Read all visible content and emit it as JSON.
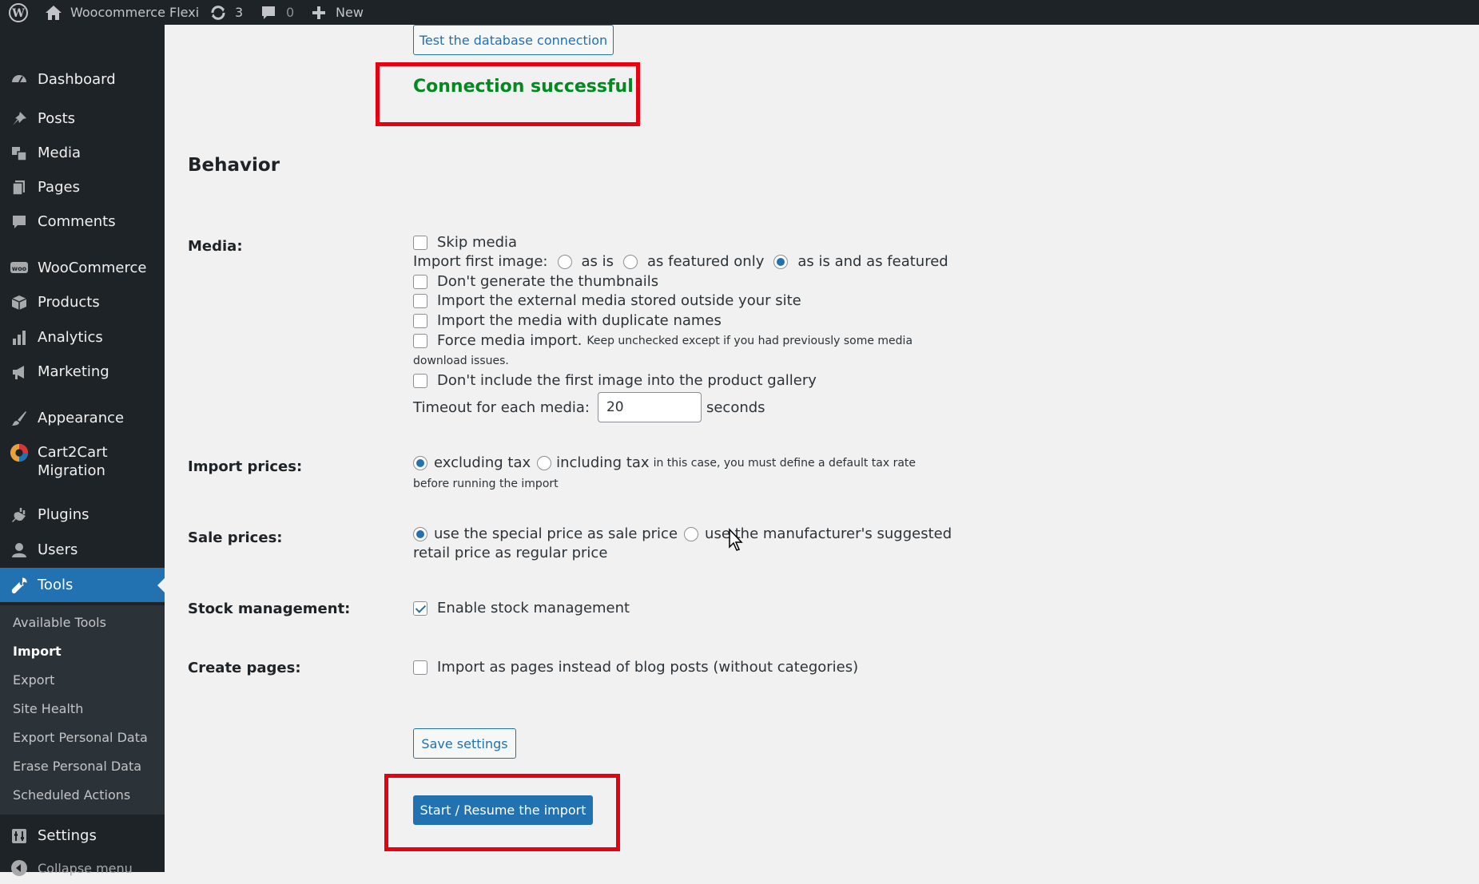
{
  "adminbar": {
    "site_name": "Woocommerce Flexi",
    "updates_count": "3",
    "comments_count": "0",
    "new_label": "New",
    "icons": [
      "wordpress-icon",
      "home-icon",
      "updates-icon",
      "comments-icon",
      "plus-icon"
    ]
  },
  "sidebar": {
    "items": [
      {
        "label": "Dashboard",
        "icon": "dashboard-icon"
      },
      {
        "label": "Posts",
        "icon": "pin-icon"
      },
      {
        "label": "Media",
        "icon": "media-icon"
      },
      {
        "label": "Pages",
        "icon": "pages-icon"
      },
      {
        "label": "Comments",
        "icon": "comment-icon"
      },
      {
        "label": "WooCommerce",
        "icon": "woo-icon"
      },
      {
        "label": "Products",
        "icon": "products-icon"
      },
      {
        "label": "Analytics",
        "icon": "analytics-icon"
      },
      {
        "label": "Marketing",
        "icon": "megaphone-icon"
      },
      {
        "label": "Appearance",
        "icon": "brush-icon"
      },
      {
        "label": "Cart2Cart Migration",
        "icon": "cart2cart-icon"
      },
      {
        "label": "Plugins",
        "icon": "plug-icon"
      },
      {
        "label": "Users",
        "icon": "user-icon"
      },
      {
        "label": "Tools",
        "icon": "wrench-icon"
      },
      {
        "label": "Settings",
        "icon": "settings-icon"
      },
      {
        "label": "Collapse menu",
        "icon": "collapse-icon"
      }
    ],
    "submenu": [
      "Available Tools",
      "Import",
      "Export",
      "Site Health",
      "Export Personal Data",
      "Erase Personal Data",
      "Scheduled Actions"
    ],
    "active_item": "Tools",
    "active_subitem": "Import"
  },
  "main": {
    "test_connection_button": "Test the database connection",
    "connection_status": "Connection successful",
    "behavior_title": "Behavior",
    "media": {
      "label": "Media:",
      "skip_media": "Skip media",
      "import_first_image_label": "Import first image:",
      "first_image_options": [
        "as is",
        "as featured only",
        "as is and as featured"
      ],
      "first_image_selected": "as is and as featured",
      "dont_generate_thumbnails": "Don't generate the thumbnails",
      "import_external_media": "Import the external media stored outside your site",
      "import_duplicate_names": "Import the media with duplicate names",
      "force_media_import": "Force media import.",
      "force_media_note_1": "Keep unchecked except if you had previously some media",
      "force_media_note_2": "download issues.",
      "dont_include_first_image": "Don't include the first image into the product gallery",
      "timeout_label": "Timeout for each media:",
      "timeout_value": "20",
      "timeout_unit": "seconds"
    },
    "import_prices": {
      "label": "Import prices:",
      "excluding_tax": "excluding tax",
      "including_tax": "including tax",
      "note_1": "in this case, you must define a default tax rate",
      "note_2": "before running the import",
      "selected": "excluding tax"
    },
    "sale_prices": {
      "label": "Sale prices:",
      "option_1": "use the special price as sale price",
      "option_2a": "use the manufacturer's suggested",
      "option_2b": "retail price as regular price",
      "selected": "use the special price as sale price"
    },
    "stock": {
      "label": "Stock management:",
      "enable": "Enable stock management",
      "checked": true
    },
    "create_pages": {
      "label": "Create pages:",
      "option": "Import as pages instead of blog posts (without categories)"
    },
    "save_button": "Save settings",
    "start_button": "Start / Resume the import"
  },
  "colors": {
    "admin_dark": "#1d2327",
    "accent_blue": "#2271b1",
    "success_green": "#008a20",
    "highlight_red": "#e60012"
  }
}
